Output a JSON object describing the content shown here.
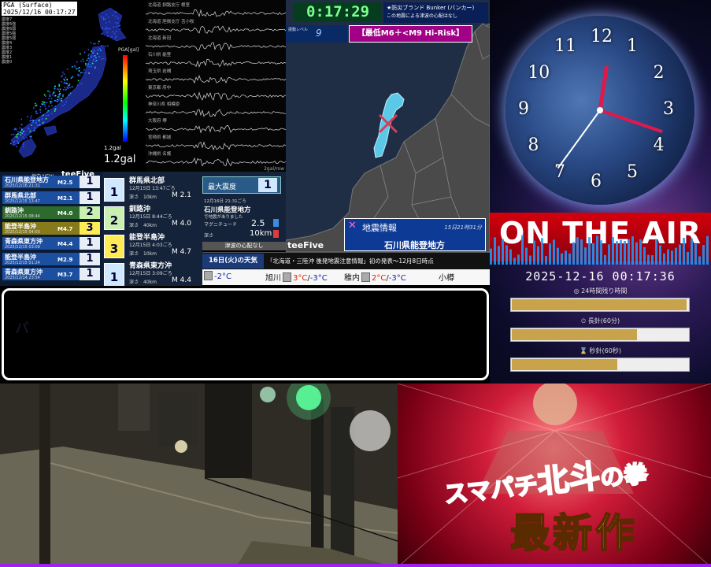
{
  "pga": {
    "label": "PGA (Surface)",
    "datetime": "2025/12/16 00:17:27",
    "legend": [
      "震度7",
      "震度6強",
      "震度6弱",
      "震度5強",
      "震度5弱",
      "震度4",
      "震度3",
      "震度2",
      "震度1",
      "震度0"
    ],
    "scale_title": "PGA[gal]",
    "gal_small": "1.2gal",
    "gal": "1.2gal"
  },
  "waveform": {
    "stations": [
      "北海道 釧路支庁 根室",
      "北海道 胆振支庁 苫小牧",
      "北海道 新冠",
      "石川県 能登",
      "埼玉県 岩槻",
      "東京都 府中",
      "神奈川県 相模原",
      "大阪府 堺",
      "宮崎県 都城",
      "沖縄県 名護"
    ],
    "unit": "2gal/row"
  },
  "quake_list": {
    "header": "地中 NEW",
    "logo": "teeFive",
    "items": [
      {
        "title": "石川県能登地方",
        "time": "2025/12/16 21:31",
        "mag": "M2.5",
        "shindo": "1"
      },
      {
        "title": "群馬県北部",
        "time": "2025/12/15 13:47",
        "mag": "M2.1",
        "shindo": "1"
      },
      {
        "title": "釧路沖",
        "time": "2025/12/15 08:44",
        "mag": "M4.0",
        "shindo": "2"
      },
      {
        "title": "能登半島沖",
        "time": "2025/12/15 04:03",
        "mag": "M4.7",
        "shindo": "3"
      },
      {
        "title": "青森県東方沖",
        "time": "2025/12/15 03:09",
        "mag": "M4.4",
        "shindo": "1"
      },
      {
        "title": "能登半島沖",
        "time": "2025/12/15 01:24",
        "mag": "M2.9",
        "shindo": "1"
      },
      {
        "title": "青森県東方沖",
        "time": "2025/12/14 23:54",
        "mag": "M3.7",
        "shindo": "1"
      }
    ]
  },
  "quake_detail": {
    "items": [
      {
        "place": "群馬県北部",
        "date": "12月15日 13:47ごろ",
        "depth": "深さ　10km",
        "mag": "M 2.1",
        "shindo": "1",
        "color": "blue"
      },
      {
        "place": "釧路沖",
        "date": "12月15日 8:44ごろ",
        "depth": "深さ　40km",
        "mag": "M 4.0",
        "shindo": "2",
        "color": "green"
      },
      {
        "place": "能登半島沖",
        "date": "12月15日 4:03ごろ",
        "depth": "深さ　10km",
        "mag": "M 4.7",
        "shindo": "3",
        "color": "yellow"
      },
      {
        "place": "青森県東方沖",
        "date": "12月15日 3:09ごろ",
        "depth": "深さ　40km",
        "mag": "M 4.4",
        "shindo": "1",
        "color": "blue"
      }
    ]
  },
  "max_intensity": {
    "label": "最大震度",
    "value": "1",
    "datetime": "12月16日 21:31ごろ",
    "place": "石川県能登地方",
    "note": "で地震がありました",
    "mag_label": "マグニチュード",
    "mag_value": "2.5",
    "depth_label": "深さ",
    "depth_value": "10km",
    "tsunami": "津波の心配なし"
  },
  "map_panel": {
    "timer": "0:17:29",
    "warn_title": "★防災ブランド Bunker (バンカー)",
    "warn_text": "この地震による津波の心配はなし",
    "level_label": "振動レベル",
    "level_value": "9",
    "risk": "【最低M6＋<M9 Hi-Risk】",
    "info_title": "地震情報",
    "info_time": "15日21時31分",
    "info_place": "石川県能登地方",
    "logo": "teeFive"
  },
  "headline": {
    "date": "16日(火)の天気",
    "text": "「北海道・三陸沖 後発地震注意情報」初の発表～12月8日時点"
  },
  "weather": [
    {
      "city": "",
      "hi": "",
      "lo": "-2°C"
    },
    {
      "city": "旭川",
      "hi": "3°C",
      "lo": "-3°C"
    },
    {
      "city": "稚内",
      "hi": "2°C",
      "lo": "-3°C"
    },
    {
      "city": "小樽",
      "hi": "",
      "lo": ""
    }
  ],
  "blackbox": {
    "text": "パ"
  },
  "clock": {
    "numbers": [
      "12",
      "1",
      "2",
      "3",
      "4",
      "5",
      "6",
      "7",
      "8",
      "9",
      "10",
      "11"
    ],
    "hour": 0.29,
    "minute": 17.5,
    "second": 36,
    "onair": "ON THE AIR",
    "datetime": "2025-12-16 00:17:36",
    "bar1_label": "24時間残り時間",
    "bar1_fill": 0.99,
    "bar2_label": "長針(60分)",
    "bar2_fill": 0.71,
    "bar3_label": "秒針(60秒)",
    "bar3_fill": 0.6
  },
  "ad": {
    "line1_a": "スマパチ",
    "line1_b": "北斗",
    "line1_c": "の拳",
    "line2": "最新作"
  },
  "colors": {
    "frame": "#a020f0",
    "risk": "#a10087",
    "timer_text": "#7dff8c",
    "onair": "#d3000c"
  }
}
